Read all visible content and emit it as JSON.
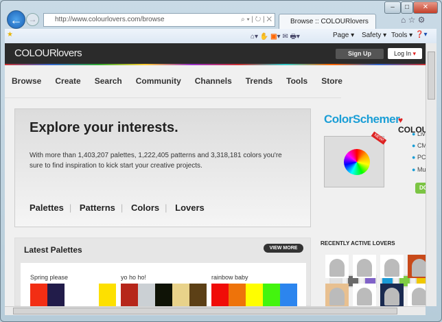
{
  "browser": {
    "url": "http://www.colourlovers.com/browse",
    "tab_title": "Browse :: COLOURlovers",
    "menus": [
      "Page",
      "Safety",
      "Tools"
    ]
  },
  "site": {
    "logo": "COLOURlovers",
    "signup": "Sign Up",
    "login": "Log In",
    "nav": [
      "Browse",
      "Create",
      "Search",
      "Community",
      "Channels",
      "Trends",
      "Tools",
      "Store"
    ]
  },
  "hero": {
    "title": "Explore your interests.",
    "text": "With more than 1,403,207 palettes, 1,222,405 patterns and 3,318,181 colors you're sure to find inspiration to kick start your creative projects.",
    "links": [
      "Palettes",
      "Patterns",
      "Colors",
      "Lovers"
    ]
  },
  "latest": {
    "title": "Latest Palettes",
    "view_more": "VIEW MORE",
    "palettes": [
      {
        "name": "Spring please",
        "colors": [
          "#f22e14",
          "#221c4a",
          "#ffffff",
          "#ffffff",
          "#fde000"
        ]
      },
      {
        "name": "yo ho ho!",
        "colors": [
          "#b6261a",
          "#cbd0d4",
          "#0f1306",
          "#e8d28a",
          "#5c4016"
        ]
      },
      {
        "name": "rainbow baby",
        "colors": [
          "#f00c08",
          "#ee730a",
          "#fffe00",
          "#43f40e",
          "#2c85ee"
        ]
      }
    ]
  },
  "sidebar": {
    "brand": "ColorSchemer",
    "partner": "COLOU",
    "badge": "NEW!",
    "bullets": [
      "Liv",
      "CM",
      "PC",
      "Mu"
    ],
    "download": "DO",
    "swatches": [
      "#e0e0e0",
      "#6a6a6a",
      "#8062c8",
      "#1a9ad6",
      "#7fcd44",
      "#f0c800"
    ],
    "recent_title": "RECENTLY ACTIVE LOVERS"
  }
}
